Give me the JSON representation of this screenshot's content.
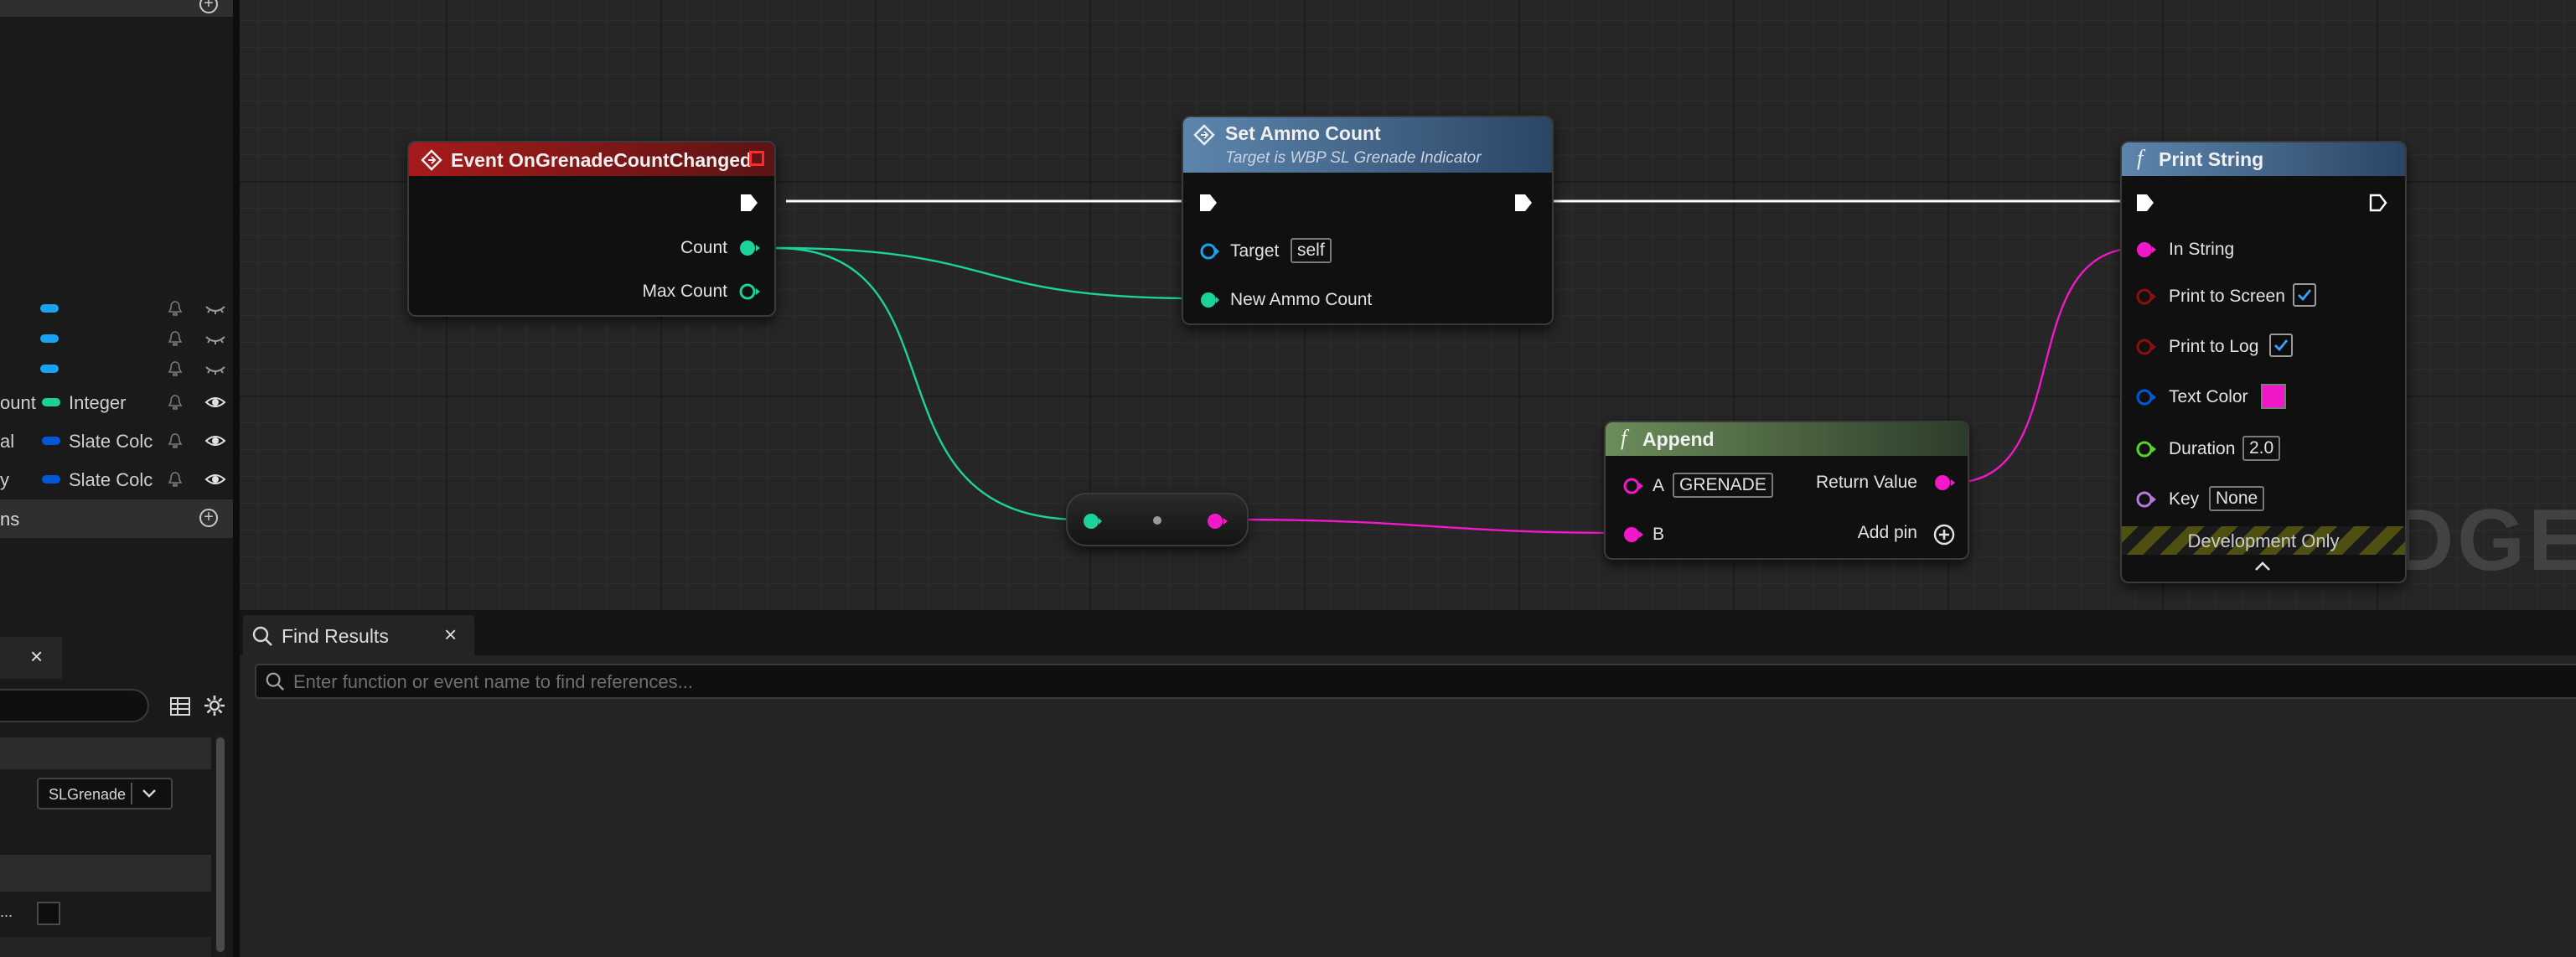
{
  "colors": {
    "exec_pin": "#ffffff",
    "integer_pin": "#1bd29b",
    "string_pin": "#f018c8",
    "bool_pin": "#8b0f0f",
    "struct_pin": "#0058d8",
    "object_pin": "#1aa2f2",
    "event_header": "#8c1818",
    "function_header": "#3c5f84",
    "pure_header": "#4a6a3a"
  },
  "left_panel": {
    "variables": [
      {
        "name": "",
        "type": "",
        "pin_color": "#1aa2f2"
      },
      {
        "name": "",
        "type": "",
        "pin_color": "#1aa2f2"
      },
      {
        "name": "",
        "type": "",
        "pin_color": "#1aa2f2"
      },
      {
        "name": "ount",
        "type": "Integer",
        "pin_color": "#1bd29b"
      },
      {
        "name": "al",
        "type": "Slate Colc",
        "pin_color": "#0058d8"
      },
      {
        "name": "y",
        "type": "Slate Colc",
        "pin_color": "#0058d8"
      }
    ],
    "section_label": "ns",
    "lower_tab_close": "×",
    "details_selected": "SLGrenade",
    "detail_row_label": "..."
  },
  "graph": {
    "watermark": "WIDGET",
    "event_node": {
      "title": "Event OnGrenadeCountChanged",
      "pins": [
        "Count",
        "Max Count"
      ]
    },
    "set_node": {
      "title": "Set Ammo Count",
      "subtitle": "Target is WBP SL Grenade Indicator",
      "target_label": "Target",
      "target_value": "self",
      "input_label": "New Ammo Count"
    },
    "append_node": {
      "icon": "f",
      "title": "Append",
      "a_label": "A",
      "a_value": "GRENADE",
      "b_label": "B",
      "return_label": "Return Value",
      "add_pin_label": "Add pin"
    },
    "print_node": {
      "icon": "f",
      "title": "Print String",
      "in_string": "In String",
      "print_to_screen": "Print to Screen",
      "print_to_screen_checked": true,
      "print_to_log": "Print to Log",
      "print_to_log_checked": true,
      "text_color_label": "Text Color",
      "text_color": "#f018c8",
      "duration_label": "Duration",
      "duration_value": "2.0",
      "key_label": "Key",
      "key_value": "None",
      "dev_only": "Development Only"
    }
  },
  "find_results": {
    "tab_label": "Find Results",
    "close": "×",
    "placeholder": "Enter function or event name to find references..."
  }
}
